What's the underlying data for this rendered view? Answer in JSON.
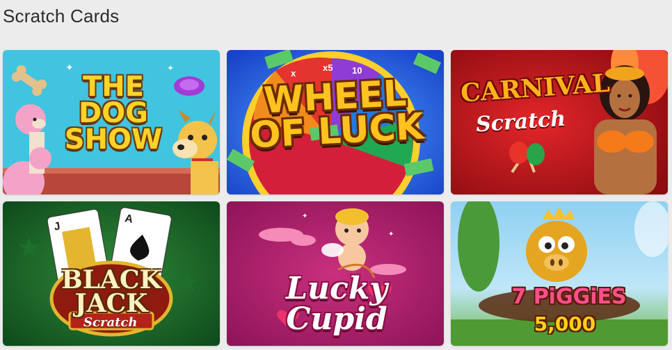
{
  "section": {
    "title": "Scratch Cards"
  },
  "cards": [
    {
      "title_lines": [
        "THE",
        "DOG",
        "SHOW"
      ],
      "theme": "#3ec2df"
    },
    {
      "title_lines": [
        "WHEEL",
        "OF LUCK"
      ],
      "theme": "#1e5be0"
    },
    {
      "title_main": "CARNIVAL",
      "title_sub": "Scratch",
      "theme": "#c71818"
    },
    {
      "title_lines": [
        "BLACK",
        "JACK"
      ],
      "title_sub": "Scratch",
      "theme": "#1d6b2b"
    },
    {
      "title_lines": [
        "Lucky",
        "Cupid"
      ],
      "theme": "#b4206b"
    },
    {
      "title_main": "7 PiGGiES",
      "title_sub": "5,000",
      "theme": "#7cc5ea"
    }
  ]
}
